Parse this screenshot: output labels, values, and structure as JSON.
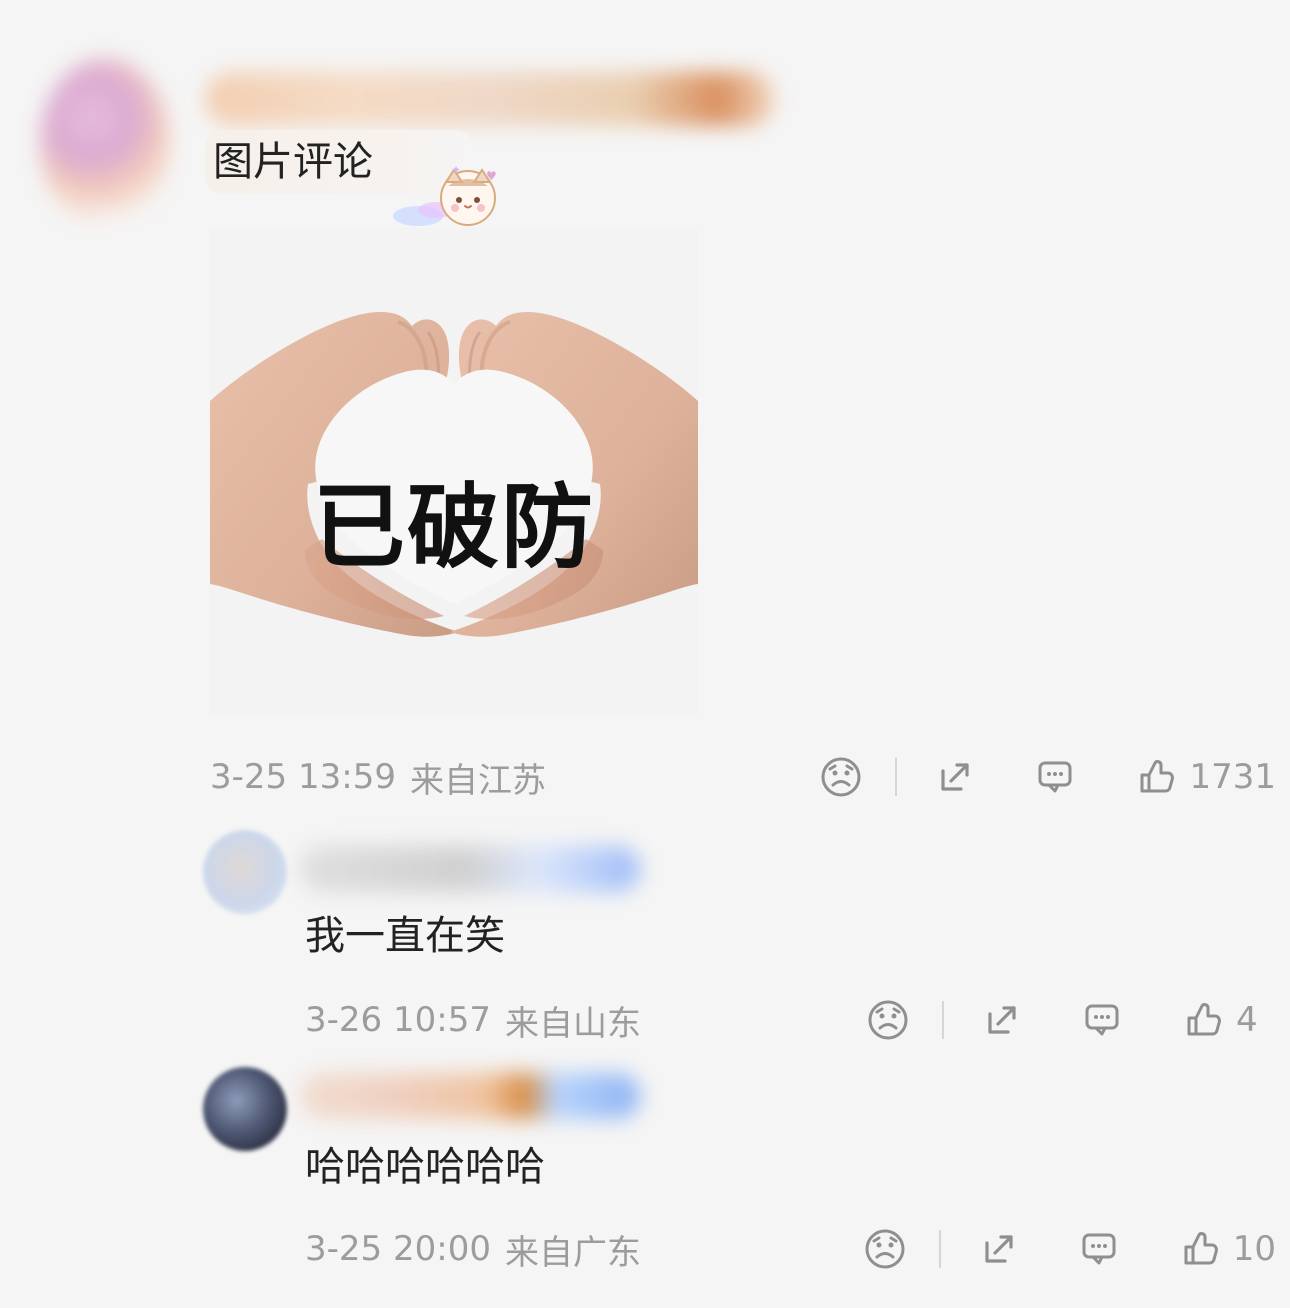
{
  "top_right_partial_text": "",
  "main_comment": {
    "text": "图片评论",
    "image": {
      "overlay_text": "已破防"
    },
    "meta": {
      "time": "3-25 13:59",
      "location": "来自江苏",
      "likes": "1731"
    }
  },
  "replies": [
    {
      "text": "我一直在笑",
      "meta": {
        "time": "3-26 10:57",
        "location": "来自山东",
        "likes": "4"
      }
    },
    {
      "text": "哈哈哈哈哈哈",
      "meta": {
        "time": "3-25 20:00",
        "location": "来自广东",
        "likes": "10"
      }
    }
  ],
  "icons": {
    "dislike": "sad-face-icon",
    "share": "share-icon",
    "comment": "comment-icon",
    "like": "thumb-up-icon"
  },
  "colors": {
    "background": "#f5f5f5",
    "meta_text": "#9c9c9c",
    "primary_text": "#222222"
  }
}
